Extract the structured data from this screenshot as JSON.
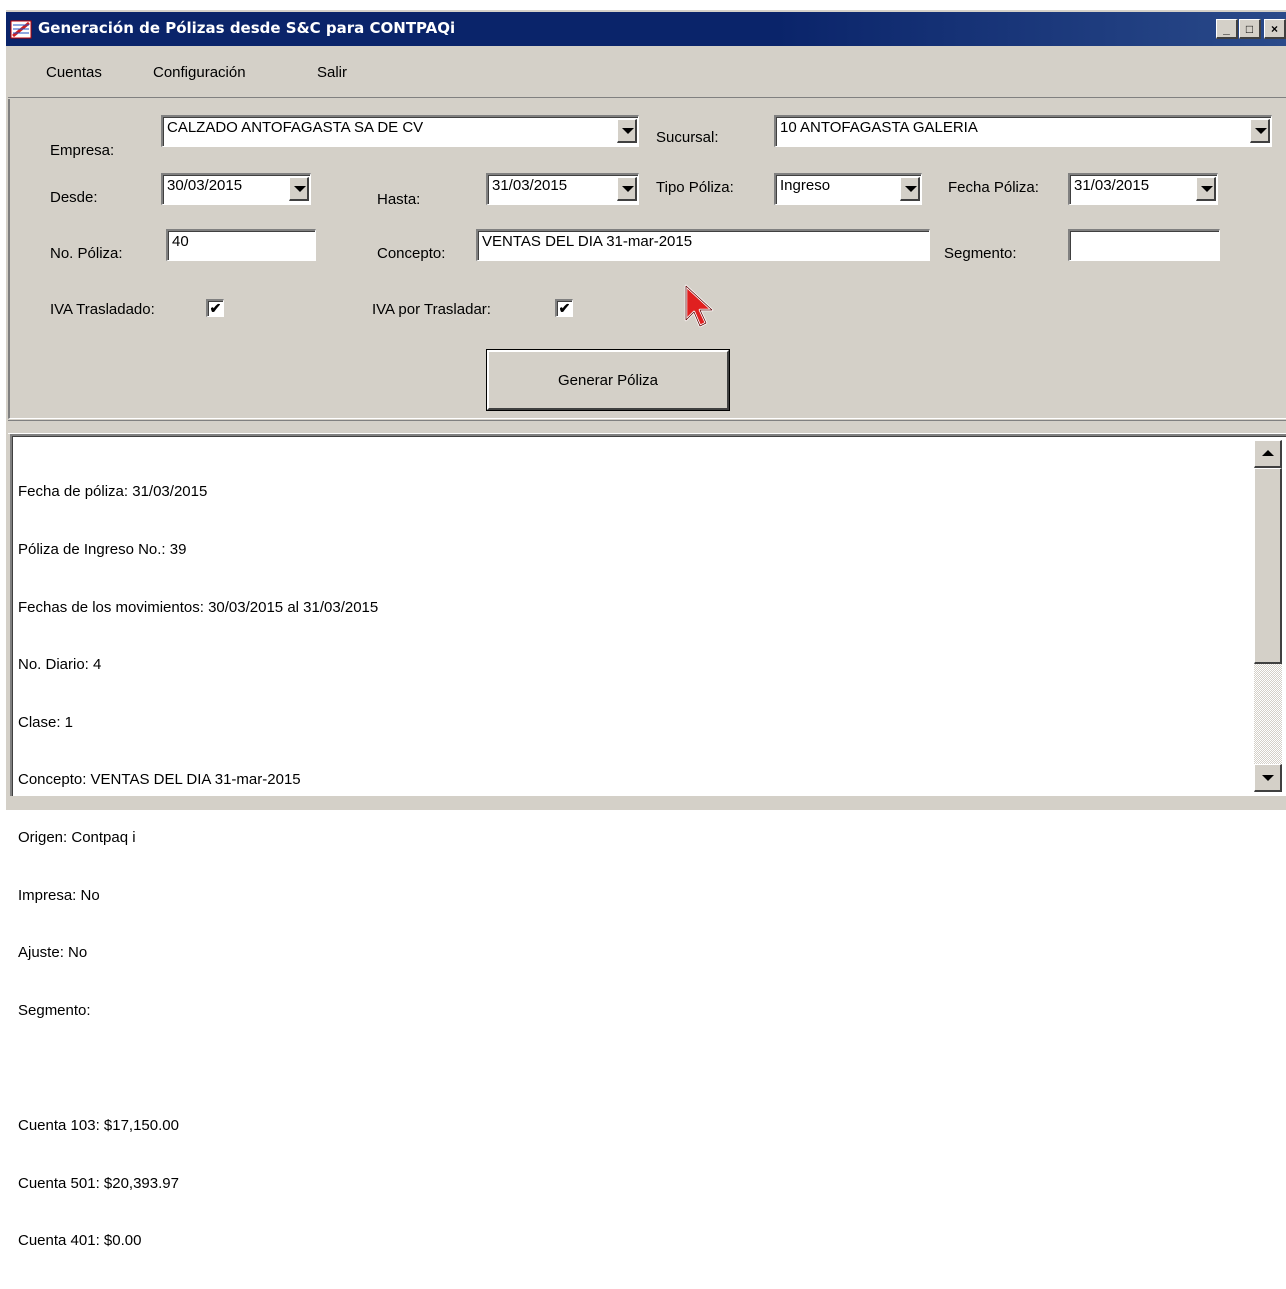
{
  "window": {
    "title": "Generación de Pólizas desde S&C para CONTPAQi",
    "minimize_glyph": "_",
    "maximize_glyph": "□",
    "close_glyph": "×",
    "icon": "app-icon"
  },
  "menu": [
    "Cuentas",
    "Configuración",
    "Salir"
  ],
  "form": {
    "empresa_label": "Empresa:",
    "empresa_value": "CALZADO ANTOFAGASTA SA DE CV",
    "sucursal_label": "Sucursal:",
    "sucursal_value": "10 ANTOFAGASTA GALERIA",
    "desde_label": "Desde:",
    "desde_value": "30/03/2015",
    "hasta_label": "Hasta:",
    "hasta_value": "31/03/2015",
    "tipo_poliza_label": "Tipo Póliza:",
    "tipo_poliza_value": "Ingreso",
    "fecha_poliza_label": "Fecha Póliza:",
    "fecha_poliza_value": "31/03/2015",
    "no_poliza_label": "No. Póliza:",
    "no_poliza_value": "40",
    "concepto_label": "Concepto:",
    "concepto_value": "VENTAS DEL DIA 31-mar-2015",
    "segmento_label": "Segmento:",
    "segmento_value": "",
    "iva_trasladado_label": "IVA Trasladado:",
    "iva_trasladado_checked": true,
    "iva_por_trasladar_label": "IVA por Trasladar:",
    "iva_por_trasladar_checked": true,
    "check_glyph": "✔",
    "generate_button": "Generar Póliza"
  },
  "output": {
    "lines": [
      "Fecha de póliza: 31/03/2015",
      "Póliza de Ingreso No.: 39",
      "Fechas de los movimientos: 30/03/2015 al 31/03/2015",
      "No. Diario: 4",
      "Clase: 1",
      "Concepto: VENTAS DEL DIA 31-mar-2015",
      "Origen: Contpaq i",
      "Impresa: No",
      "Ajuste: No",
      "Segmento:",
      "",
      "Cuenta 103: $17,150.00",
      "Cuenta 501: $20,393.97",
      "Cuenta 401: $0.00"
    ]
  },
  "colors": {
    "titlebar": "#0a246a",
    "face": "#d4d0c8"
  }
}
